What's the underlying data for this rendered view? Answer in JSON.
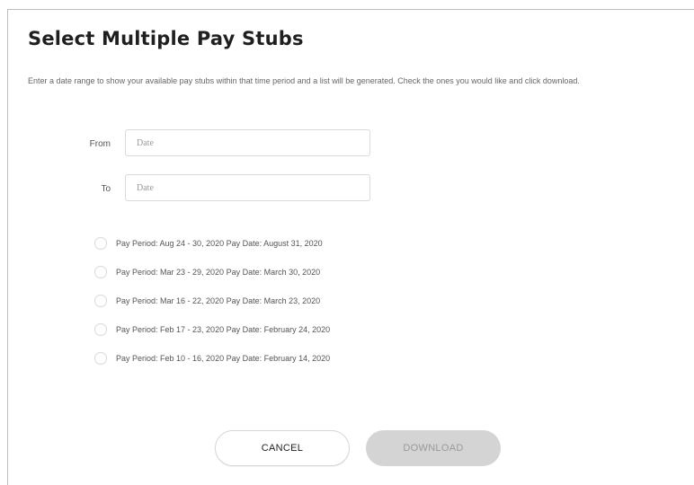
{
  "dialog": {
    "title": "Select Multiple Pay Stubs",
    "description": "Enter a date range to show your available pay stubs within that time period and a list will be generated. Check the ones you would like and click download."
  },
  "form": {
    "from_label": "From",
    "from_placeholder": "Date",
    "from_value": "",
    "to_label": "To",
    "to_placeholder": "Date",
    "to_value": ""
  },
  "pay_stubs": [
    {
      "label": "Pay Period: Aug 24 - 30, 2020 Pay Date: August 31, 2020",
      "checked": false
    },
    {
      "label": "Pay Period: Mar 23 - 29, 2020 Pay Date: March 30, 2020",
      "checked": false
    },
    {
      "label": "Pay Period: Mar 16 - 22, 2020 Pay Date: March 23, 2020",
      "checked": false
    },
    {
      "label": "Pay Period: Feb 17 - 23, 2020 Pay Date: February 24, 2020",
      "checked": false
    },
    {
      "label": "Pay Period: Feb 10 - 16, 2020 Pay Date: February 14, 2020",
      "checked": false
    }
  ],
  "actions": {
    "cancel_label": "CANCEL",
    "download_label": "DOWNLOAD",
    "download_enabled": false
  },
  "colors": {
    "title": "#1f1f1f",
    "download_bg": "#d4d4d4",
    "download_text": "#9a9a9a",
    "border": "#dadada"
  }
}
